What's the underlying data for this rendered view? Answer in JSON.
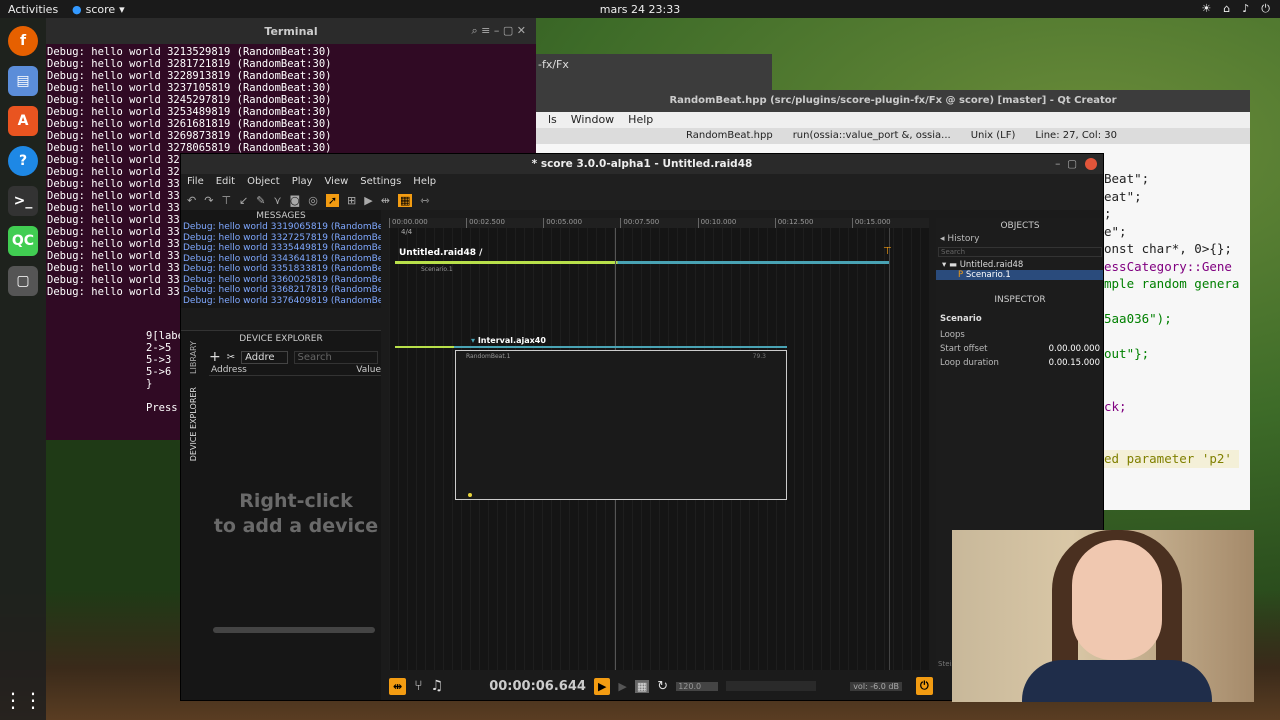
{
  "topbar": {
    "activities": "Activities",
    "app": "score",
    "clock": "mars 24  23:33"
  },
  "terminal": {
    "title": "Terminal",
    "lines": [
      "Debug: hello world 3213529819 (RandomBeat:30)",
      "Debug: hello world 3281721819 (RandomBeat:30)",
      "Debug: hello world 3228913819 (RandomBeat:30)",
      "Debug: hello world 3237105819 (RandomBeat:30)",
      "Debug: hello world 3245297819 (RandomBeat:30)",
      "Debug: hello world 3253489819 (RandomBeat:30)",
      "Debug: hello world 3261681819 (RandomBeat:30)",
      "Debug: hello world 3269873819 (RandomBeat:30)",
      "Debug: hello world 3278065819 (RandomBeat:30)",
      "Debug: hello world 328",
      "Debug: hello world 329",
      "Debug: hello world 330",
      "Debug: hello world 331",
      "Debug: hello world 331",
      "Debug: hello world 332",
      "Debug: hello world 333",
      "Debug: hello world 334",
      "Debug: hello world 335",
      "Debug: hello world 336",
      "Debug: hello world 337",
      "Debug: hello world 338"
    ],
    "tail": [
      "9[labe",
      "2->5",
      "5->3",
      "5->6",
      "}",
      "",
      "Press"
    ]
  },
  "fx_window": {
    "title": "-fx/Fx"
  },
  "qtcreator": {
    "title": "RandomBeat.hpp (src/plugins/score-plugin-fx/Fx @ score) [master] - Qt Creator",
    "menus": [
      "ls",
      "Window",
      "Help"
    ],
    "file": "RandomBeat.hpp",
    "func": "run(ossia::value_port &, ossia...",
    "eol": "Unix (LF)",
    "pos": "Line: 27, Col: 30",
    "code": [
      "Beat\";",
      "eat\";",
      ";",
      "e\";",
      "onst char*, 0>{};",
      "essCategory::Gene",
      "mple random genera",
      "",
      "5aa036\");",
      "",
      "out\"};",
      "",
      "",
      "ck;",
      "",
      "",
      "ed parameter 'p2'"
    ]
  },
  "score": {
    "title": "* score 3.0.0-alpha1 - Untitled.raid48",
    "menus": [
      "File",
      "Edit",
      "Object",
      "Play",
      "View",
      "Settings",
      "Help"
    ],
    "messages_title": "MESSAGES",
    "messages": [
      "Debug: hello world 3319065819 (RandomBeat:3",
      "Debug: hello world 3327257819 (RandomBeat:3",
      "Debug: hello world 3335449819 (RandomBeat:3",
      "Debug: hello world 3343641819 (RandomBeat:3",
      "Debug: hello world 3351833819 (RandomBeat:3",
      "Debug: hello world 3360025819 (RandomBeat:3",
      "Debug: hello world 3368217819 (RandomBeat:3",
      "Debug: hello world 3376409819 (RandomBeat:3"
    ],
    "device_explorer": "DEVICE EXPLORER",
    "library_tab": "LIBRARY",
    "device_tab": "DEVICE EXPLORER",
    "address_select": "Addre",
    "search_placeholder": "Search",
    "col_address": "Address",
    "col_value": "Value",
    "right_click_1": "Right-click",
    "right_click_2": "to add a device",
    "ruler": [
      "00:00.000",
      "00:02.500",
      "00:05.000",
      "00:07.500",
      "00:10.000",
      "00:12.500",
      "00:15.000"
    ],
    "timesig": "4/4",
    "breadcrumb": "Untitled.raid48 /",
    "scenario_label": "Scenario.1",
    "interval_label": "Interval.ajax40",
    "process_label": "RandomBeat.1",
    "process_num": "79.3",
    "objects_title": "OBJECTS",
    "history": "History",
    "obj_search": "Search",
    "tree_root": "Untitled.raid48",
    "tree_child": "Scenario.1",
    "inspector_title": "INSPECTOR",
    "insp_name": "Scenario",
    "loops": "Loops",
    "start_offset_label": "Start offset",
    "start_offset_val": "0.00.00.000",
    "loop_dur_label": "Loop duration",
    "loop_dur_val": "0.00.15.000",
    "timecode": "00:00:06.644",
    "tempo": "120.0",
    "volume": "vol: -6.0 dB",
    "steis": "Steis"
  }
}
